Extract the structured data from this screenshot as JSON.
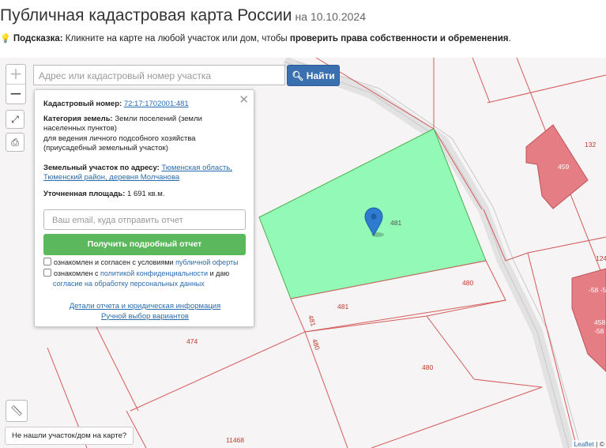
{
  "header": {
    "title": "Публичная кадастровая карта России",
    "date": "на 10.10.2024"
  },
  "hint": {
    "label": "Подсказка:",
    "text": " Кликните на карте на любой участок или дом, чтобы ",
    "bold": "проверить права собственности и обременения",
    "end": "."
  },
  "search": {
    "placeholder": "Адрес или кадастровый номер участка",
    "button": "Найти"
  },
  "zoom": {
    "in": "+",
    "out": "−"
  },
  "panel": {
    "cad_label": "Кадастровый номер:",
    "cad_value": "72:17:1702001:481",
    "cat_label": "Категория земель:",
    "cat_line1": " Земли поселений (земли",
    "cat_line2": "населенных пунктов)",
    "cat_line3": "для ведения личного подсобного хозяйства",
    "cat_line4": "(приусадебный земельный участок)",
    "addr_label": "Земельный участок по адресу:",
    "addr_line1": "Тюменская область,",
    "addr_line2": "Тюменский район, деревня Молчанова",
    "area_label": "Уточненная площадь:",
    "area_value": " 1 691 кв.м.",
    "email_placeholder": "Ваш email, куда отправить отчет",
    "report_button": "Получить подробный отчет",
    "chk1_text": "ознакомлен и согласен с условиями ",
    "chk1_link": "публичной оферты",
    "chk2_text": "ознакомлен с ",
    "chk2_link": "политикой конфиденциальности",
    "chk2_tail": " и даю",
    "chk2_link2": "согласие на обработку персональных данных",
    "link1": "Детали отчета и юридическая информация",
    "link2": "Ручной выбор вариантов"
  },
  "map_labels": {
    "p481": "481",
    "p481b": "481",
    "p481c": "481",
    "p480a": "480",
    "p480b": "480",
    "p480c": "480",
    "p474": "474",
    "p132": "132",
    "p459": "459",
    "p124": "124",
    "p11468": "11468",
    "b58a": "-58 -5",
    "b58b": "458",
    "b58c": "-58"
  },
  "notfound": "Не нашли участок/дом на карте?",
  "attribution": {
    "leaflet": "Leaflet",
    "rest": " | ©"
  },
  "colors": {
    "parcel": "#93f9b6",
    "building": "#e57e84",
    "boundary": "#d45a5a",
    "button": "#3a6fb0",
    "report": "#5cb85c"
  }
}
